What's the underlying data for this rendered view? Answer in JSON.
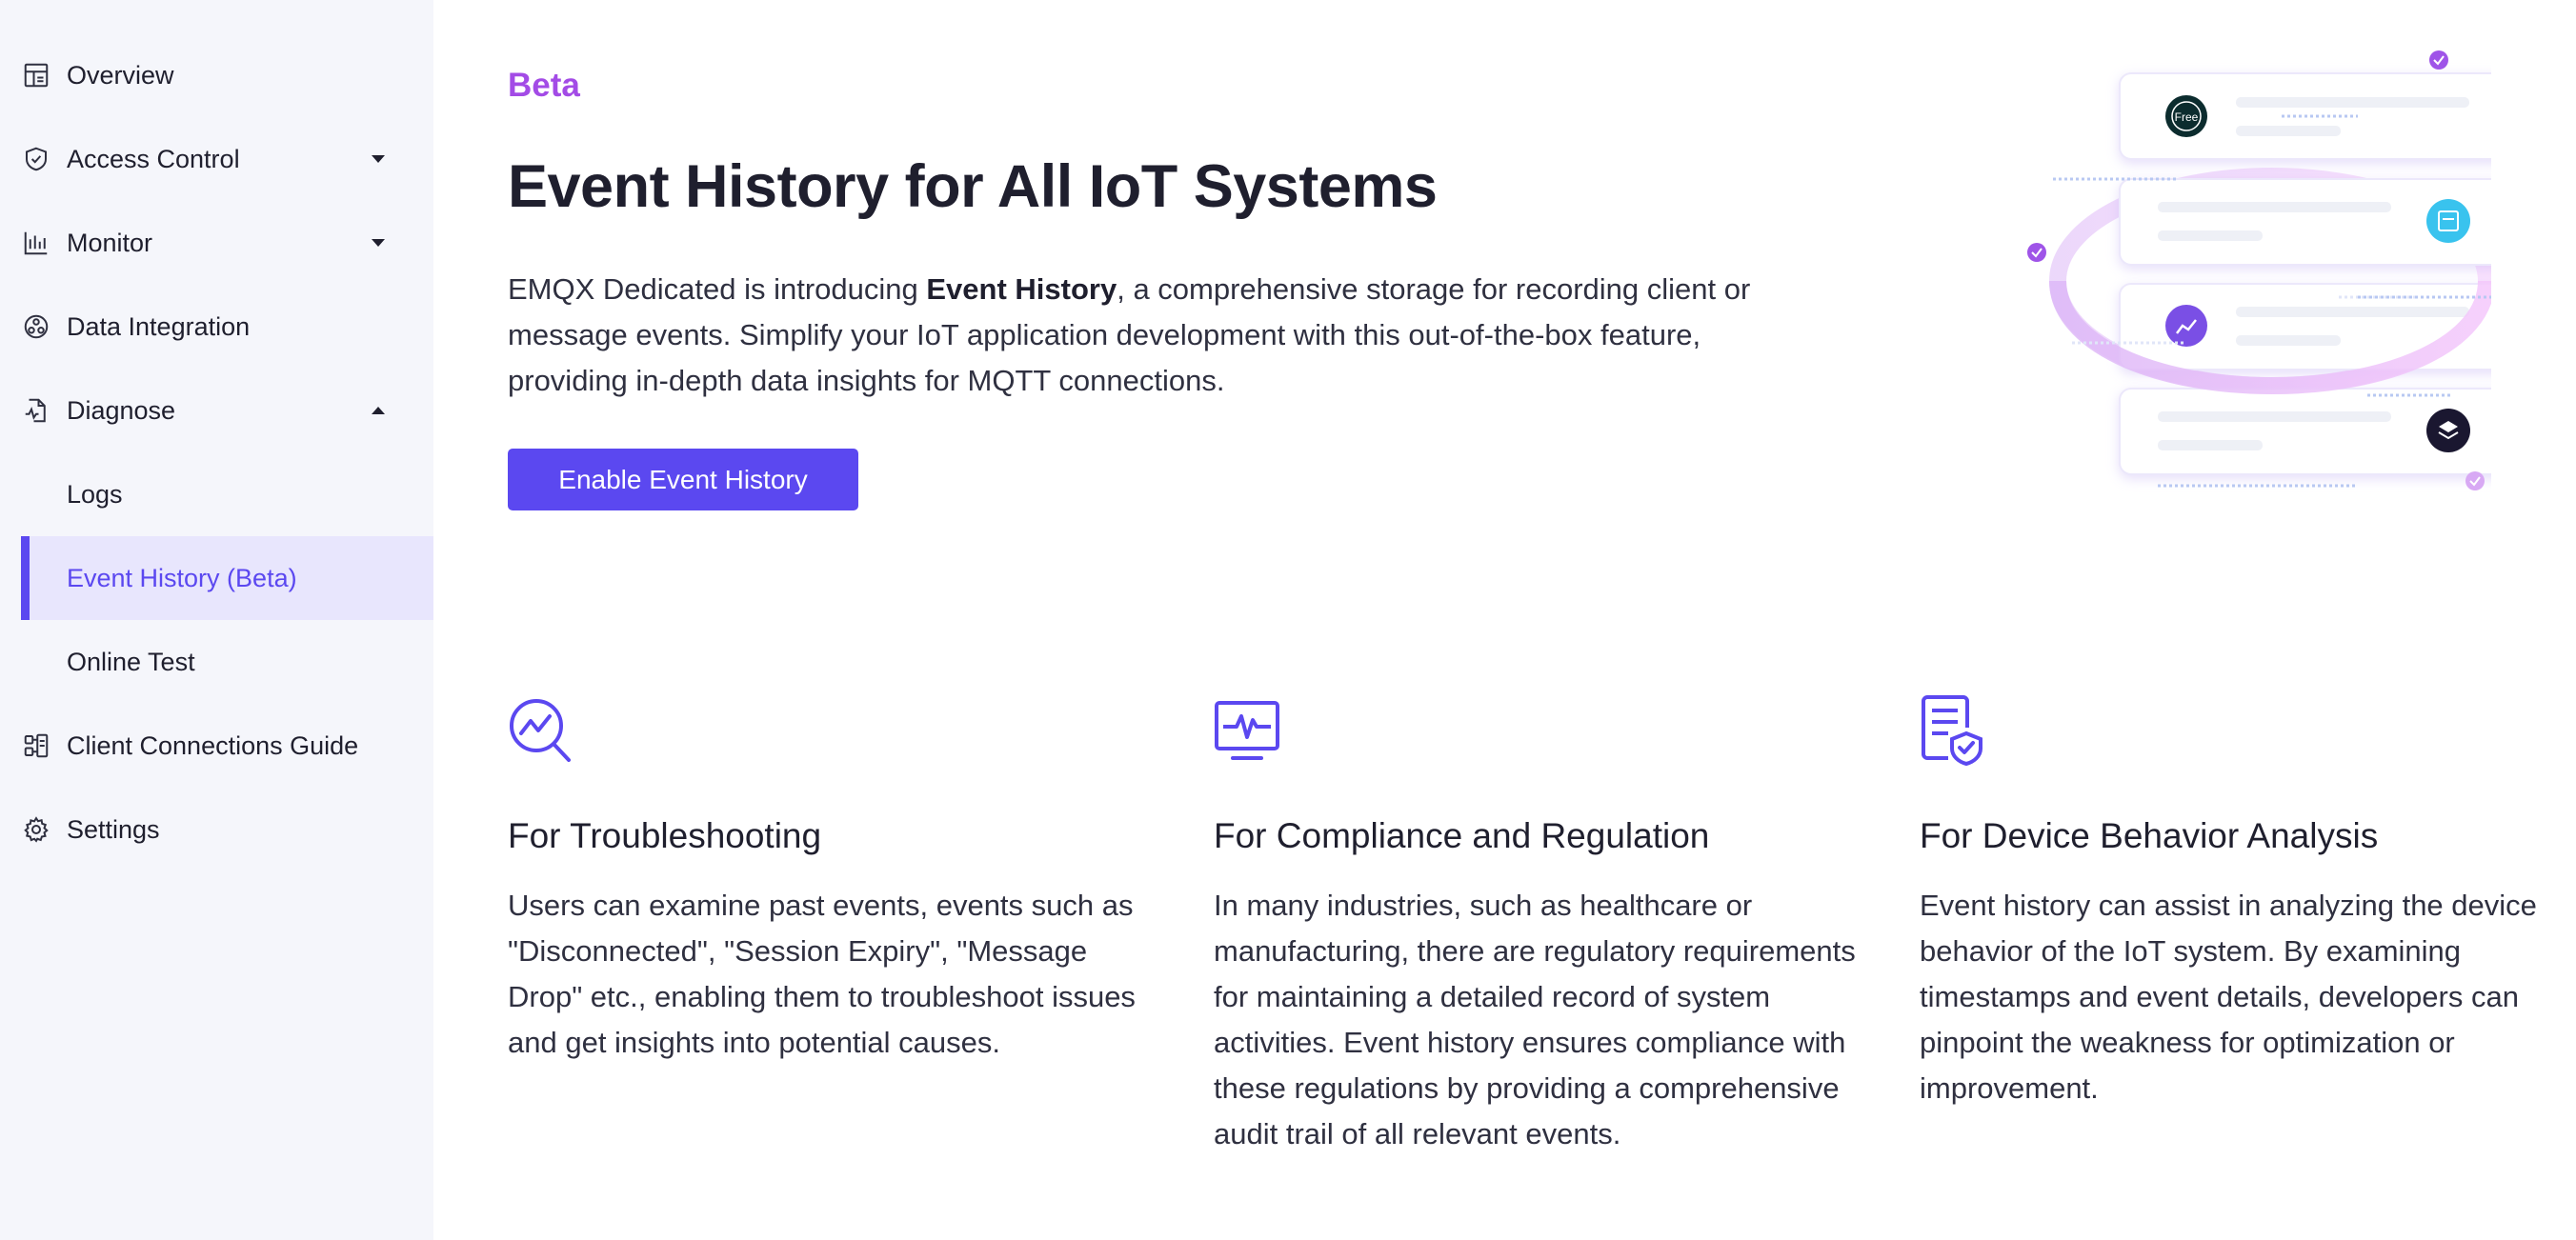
{
  "sidebar": {
    "items": [
      {
        "label": "Overview",
        "icon": "dashboard-icon"
      },
      {
        "label": "Access Control",
        "icon": "shield-icon",
        "chevron": "down"
      },
      {
        "label": "Monitor",
        "icon": "bar-chart-icon",
        "chevron": "down"
      },
      {
        "label": "Data Integration",
        "icon": "integration-icon"
      },
      {
        "label": "Diagnose",
        "icon": "diagnose-icon",
        "chevron": "up"
      },
      {
        "label": "Logs",
        "sub": true
      },
      {
        "label": "Event History (Beta)",
        "sub": true,
        "active": true
      },
      {
        "label": "Online Test",
        "sub": true
      },
      {
        "label": "Client Connections Guide",
        "icon": "connections-icon"
      },
      {
        "label": "Settings",
        "icon": "gear-icon"
      }
    ]
  },
  "main": {
    "beta_label": "Beta",
    "title": "Event History for All IoT Systems",
    "intro": {
      "before": "EMQX Dedicated is introducing ",
      "bold": "Event History",
      "after": ", a comprehensive storage for recording client or message events. Simplify your IoT application development with this out-of-the-box feature, providing in-depth data insights for MQTT connections."
    },
    "enable_button": "Enable Event History",
    "illustration": {
      "free_badge": "Free"
    },
    "features": [
      {
        "icon": "troubleshoot-icon",
        "title": "For Troubleshooting",
        "text": "Users can examine past events, events such as \"Disconnected\", \"Session Expiry\", \"Message Drop\" etc., enabling them to troubleshoot issues and get insights into potential causes."
      },
      {
        "icon": "monitor-pulse-icon",
        "title": "For Compliance and Regulation",
        "text": "In many industries, such as healthcare or manufacturing, there are regulatory requirements for maintaining a detailed record of system activities. Event history ensures compliance with these regulations by providing a comprehensive audit trail of all relevant events."
      },
      {
        "icon": "document-shield-icon",
        "title": "For Device Behavior Analysis",
        "text": "Event history can assist in analyzing the device behavior of the IoT system. By examining timestamps and event details, developers can pinpoint the weakness for optimization or improvement."
      }
    ]
  },
  "colors": {
    "accent": "#5b48f0",
    "beta": "#a34be6",
    "sidebar_bg": "#f5f6fb",
    "active_bg": "#e8e6fd"
  }
}
